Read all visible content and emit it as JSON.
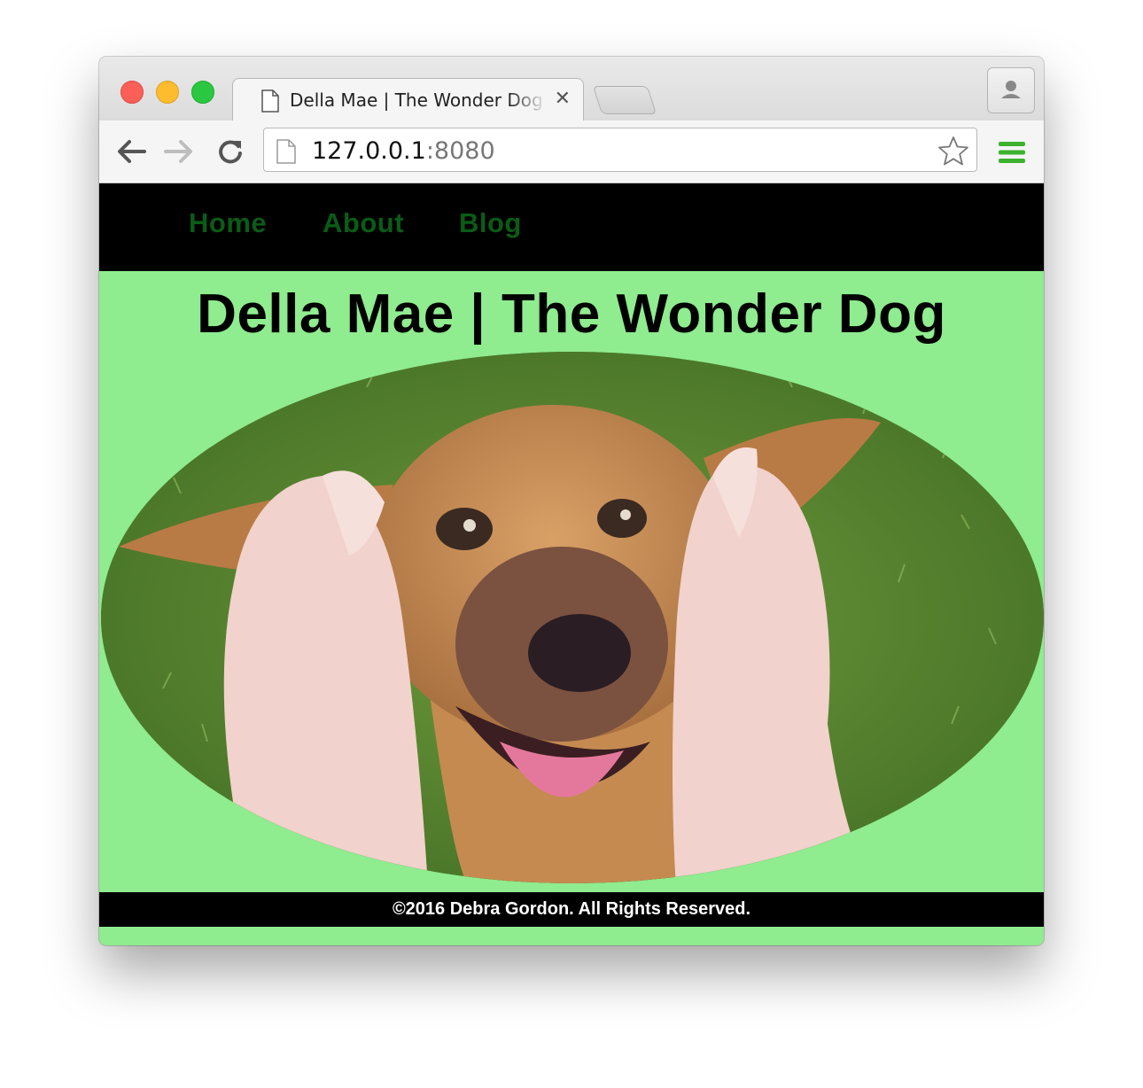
{
  "browser": {
    "tab_title": "Della Mae | The Wonder Dog",
    "tab_close_glyph": "✕",
    "url_host": "127.0.0.1",
    "url_port": ":8080"
  },
  "site": {
    "nav": [
      {
        "label": "Home"
      },
      {
        "label": "About"
      },
      {
        "label": "Blog"
      }
    ],
    "title": "Della Mae | The Wonder Dog",
    "hero_image_subject": "dog-photo",
    "footer": "©2016 Debra Gordon. All Rights Reserved."
  },
  "colors": {
    "page_background": "#8fec8f",
    "nav_background": "#000000",
    "nav_link": "#0a5c16",
    "footer_background": "#000000",
    "footer_text": "#ffffff"
  }
}
